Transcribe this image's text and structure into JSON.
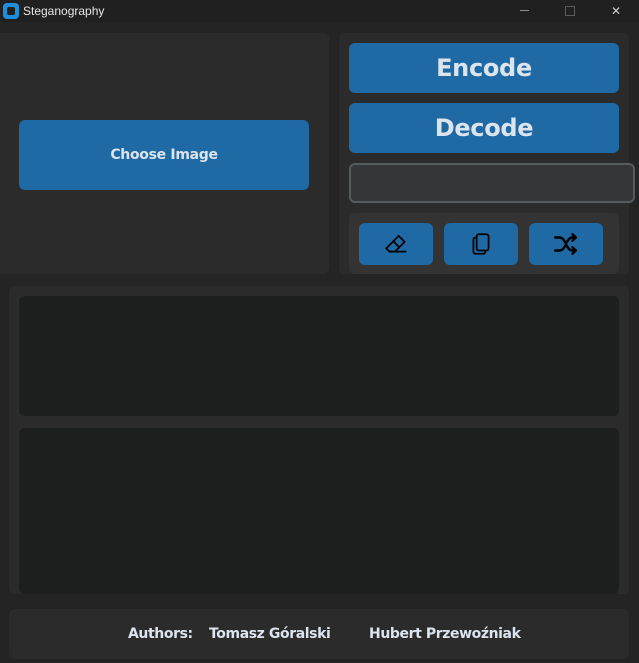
{
  "window": {
    "title": "Steganography",
    "minimize_glyph": "",
    "maximize_glyph": "",
    "close_glyph": "✕"
  },
  "left_panel": {
    "choose_image_label": "Choose Image"
  },
  "right_panel": {
    "encode_label": "Encode",
    "decode_label": "Decode",
    "key_input_value": "",
    "key_input_placeholder": "",
    "tools": [
      {
        "icon": "eraser-icon"
      },
      {
        "icon": "copy-icon"
      },
      {
        "icon": "shuffle-icon"
      }
    ]
  },
  "text_area": {
    "top_value": "",
    "bottom_value": ""
  },
  "footer": {
    "authors_label": "Authors:",
    "author_1": "Tomasz Góralski",
    "author_2": "Hubert Przewoźniak"
  },
  "colors": {
    "accent": "#1f6aa5",
    "window_bg": "#242424",
    "panel_bg": "#2b2b2b",
    "textbox_bg": "#1d1e1e",
    "text": "#dce4ee",
    "app_icon": "#1f8fdd"
  }
}
